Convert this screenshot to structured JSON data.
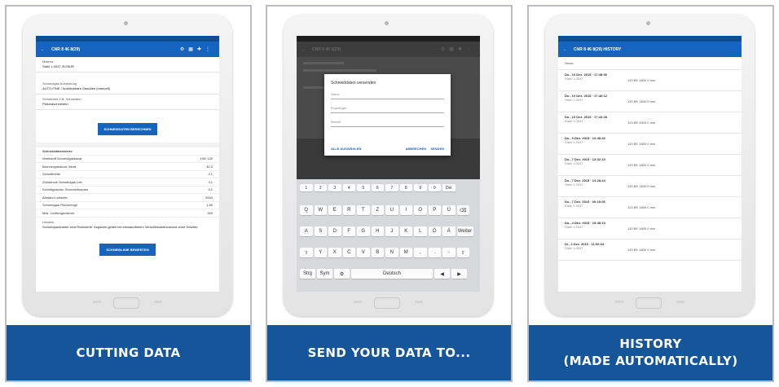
{
  "panels": [
    {
      "caption": [
        "CUTTING DATA"
      ],
      "app_title": "CNR 8 46 8(29)",
      "fields": [
        {
          "label": "Materia",
          "value": "Stahl 1.0037 /S235JR"
        },
        {
          "label": "Schneidgas Ausrüstung",
          "value": "AUTO-FINE / Aufsteckbare Gasdüse (manuell)"
        },
        {
          "label": "Schneidart Z.B. Schneiden",
          "value": "Plasmaschneiden"
        }
      ],
      "compute_button": "SCHNEIDDATEN BERECHNEN",
      "results_header": "Schneiddatenwerte",
      "results": [
        {
          "label": "Werkstoff Schneidgaskanal",
          "value": "150/ 130"
        },
        {
          "label": "Brennergasdruck Ventil",
          "value": "40.0"
        },
        {
          "label": "Schnittbreite",
          "value": "2.1"
        },
        {
          "label": "Zünddruck Schneidgas Leit.",
          "value": "3.1"
        },
        {
          "label": "Schnittgeschw. Stromaufnahme",
          "value": "5.1"
        },
        {
          "label": "Abstand Leitseite",
          "value": "3000"
        },
        {
          "label": "Schneidgas Fließmenge",
          "value": "1.80"
        },
        {
          "label": "Max. Lichtbogenstrom",
          "value": "160"
        }
      ],
      "note_label": "Hinweis",
      "note_text": "Schneidparameter sind Richtwerte. Angaben gelten bei einwandfreiem Verschleissteilzustand ohne Gewähr.",
      "footer_button": "SCHNEIDLINIE BEWERTEN"
    },
    {
      "caption": [
        "SEND YOUR DATA TO..."
      ],
      "app_title": "CNR 8 46 8(29)",
      "dialog_title": "Schneiddaten versenden",
      "dialog_fields": [
        "Name",
        "Empfänger",
        "Betreff"
      ],
      "dialog_left_button": "ALLE AUSWÄHLEN",
      "dialog_right_buttons": [
        "ABBRECHEN",
        "SENDEN"
      ],
      "keyboard": {
        "row0": [
          "1",
          "2",
          "3",
          "4",
          "5",
          "6",
          "7",
          "8",
          "9",
          "0",
          "Del"
        ],
        "row1": [
          "Q",
          "W",
          "E",
          "R",
          "T",
          "Z",
          "U",
          "I",
          "O",
          "P",
          "Ü",
          "⌫"
        ],
        "row2": [
          "A",
          "S",
          "D",
          "F",
          "G",
          "H",
          "J",
          "K",
          "L",
          "Ö",
          "Ä",
          "Weiter"
        ],
        "row3": [
          "⇧",
          "Y",
          "X",
          "C",
          "V",
          "B",
          "N",
          "M",
          ",",
          ".",
          "-",
          "⇧"
        ],
        "row4": [
          "Strg",
          "Sym",
          "⚙",
          "Deutsch",
          "◀",
          "▶"
        ]
      }
    },
    {
      "caption": [
        "HISTORY",
        "(MADE AUTOMATICALLY)"
      ],
      "app_title": "CNR 8 46 8(29) HISTORY",
      "section_label": "Heute",
      "entries": [
        {
          "date": "Do., 10 Dez. 2015 · 17:48:00",
          "sub": "Stahl 1.0037",
          "result": "120 BE 1800 0 mm"
        },
        {
          "date": "Do., 10 Dez. 2015 · 17:46:12",
          "sub": "Stahl 1.0037",
          "result": "120 BE 1800 0 mm"
        },
        {
          "date": "Do., 10 Dez. 2015 · 17:44:28",
          "sub": "Stahl 1.0037",
          "result": "120 BE 2000 0 mm"
        },
        {
          "date": "Do., 9 Dez. 2015 · 10:48:30",
          "sub": "Stahl 1.0037",
          "result": "120 BE 1800 0 mm"
        },
        {
          "date": "Do., 7 Dez. 2015 · 13:32:10",
          "sub": "Stahl 1.0037",
          "result": "120 BE 1800 0 mm"
        },
        {
          "date": "Do., 7 Dez. 2015 · 13:28:44",
          "sub": "Stahl 1.0037",
          "result": "120 BE 1800 0 mm"
        },
        {
          "date": "Do., 7 Dez. 2015 · 09:15:06",
          "sub": "Stahl 1.0037",
          "result": "120 BE 1800 0 mm"
        },
        {
          "date": "Do., 4 Dez. 2015 · 15:48:10",
          "sub": "Stahl 1.0037",
          "result": "120 BE 1800 0 mm"
        },
        {
          "date": "Di., 2 Dez. 2015 · 11:06:34",
          "sub": "Stahl 1.0037",
          "result": "120 BE 1800 0 mm"
        }
      ]
    }
  ],
  "colors": {
    "caption_bg": "#15569a",
    "appbar": "#1565c0",
    "statusbar": "#0d4e93"
  }
}
